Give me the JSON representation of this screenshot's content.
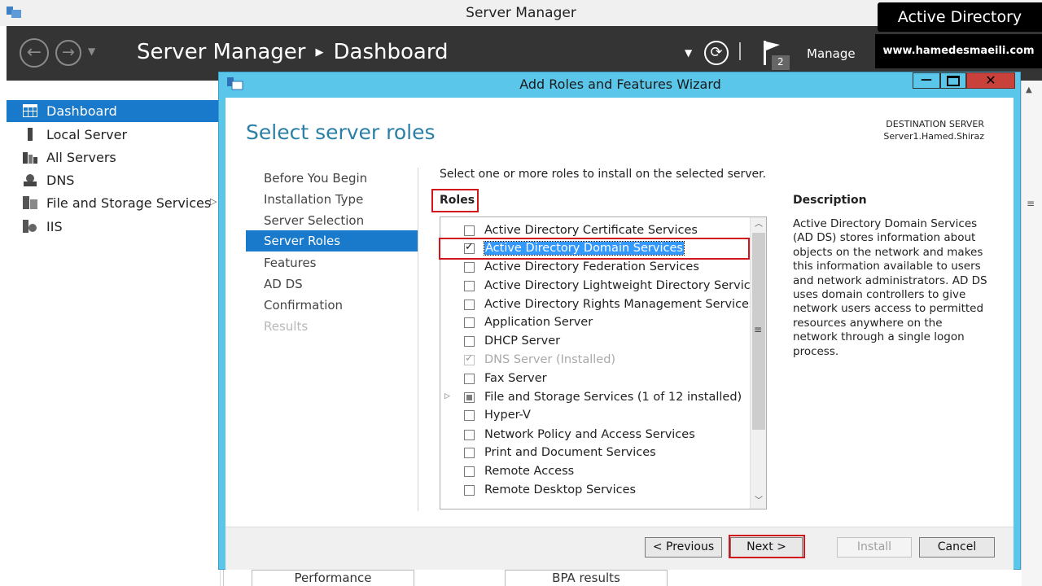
{
  "window": {
    "title": "Server Manager"
  },
  "header": {
    "crumb_root": "Server Manager",
    "crumb_page": "Dashboard",
    "flag_count": "2",
    "manage_label": "Manage"
  },
  "sidebar": {
    "items": [
      {
        "label": "Dashboard"
      },
      {
        "label": "Local Server"
      },
      {
        "label": "All Servers"
      },
      {
        "label": "DNS"
      },
      {
        "label": "File and Storage Services"
      },
      {
        "label": "IIS"
      }
    ]
  },
  "wizard": {
    "title": "Add Roles and Features Wizard",
    "page_title": "Select server roles",
    "dest_label": "DESTINATION SERVER",
    "dest_server": "Server1.Hamed.Shiraz",
    "steps": [
      {
        "label": "Before You Begin"
      },
      {
        "label": "Installation Type"
      },
      {
        "label": "Server Selection"
      },
      {
        "label": "Server Roles"
      },
      {
        "label": "Features"
      },
      {
        "label": "AD DS"
      },
      {
        "label": "Confirmation"
      },
      {
        "label": "Results"
      }
    ],
    "instructions": "Select one or more roles to install on the selected server.",
    "roles_heading": "Roles",
    "roles": [
      {
        "label": "Active Directory Certificate Services"
      },
      {
        "label": "Active Directory Domain Services"
      },
      {
        "label": "Active Directory Federation Services"
      },
      {
        "label": "Active Directory Lightweight Directory Services"
      },
      {
        "label": "Active Directory Rights Management Services"
      },
      {
        "label": "Application Server"
      },
      {
        "label": "DHCP Server"
      },
      {
        "label": "DNS Server (Installed)"
      },
      {
        "label": "Fax Server"
      },
      {
        "label": "File and Storage Services (1 of 12 installed)"
      },
      {
        "label": "Hyper-V"
      },
      {
        "label": "Network Policy and Access Services"
      },
      {
        "label": "Print and Document Services"
      },
      {
        "label": "Remote Access"
      },
      {
        "label": "Remote Desktop Services"
      }
    ],
    "description_heading": "Description",
    "description": "Active Directory Domain Services (AD DS) stores information about objects on the network and makes this information available to users and network administrators. AD DS uses domain controllers to give network users access to permitted resources anywhere on the network through a single logon process.",
    "buttons": {
      "previous": "< Previous",
      "next": "Next >",
      "install": "Install",
      "cancel": "Cancel"
    }
  },
  "background": {
    "performance": "Performance",
    "bpa": "BPA results"
  },
  "watermark": {
    "topic": "Active Directory",
    "site": "www.hamedesmaeili.com"
  },
  "colors": {
    "header_bg": "#343434",
    "accent_blue": "#1979ca",
    "wizard_title_bg": "#5ac7ea",
    "page_title": "#2b7fa5",
    "highlight": "#d0161c"
  }
}
